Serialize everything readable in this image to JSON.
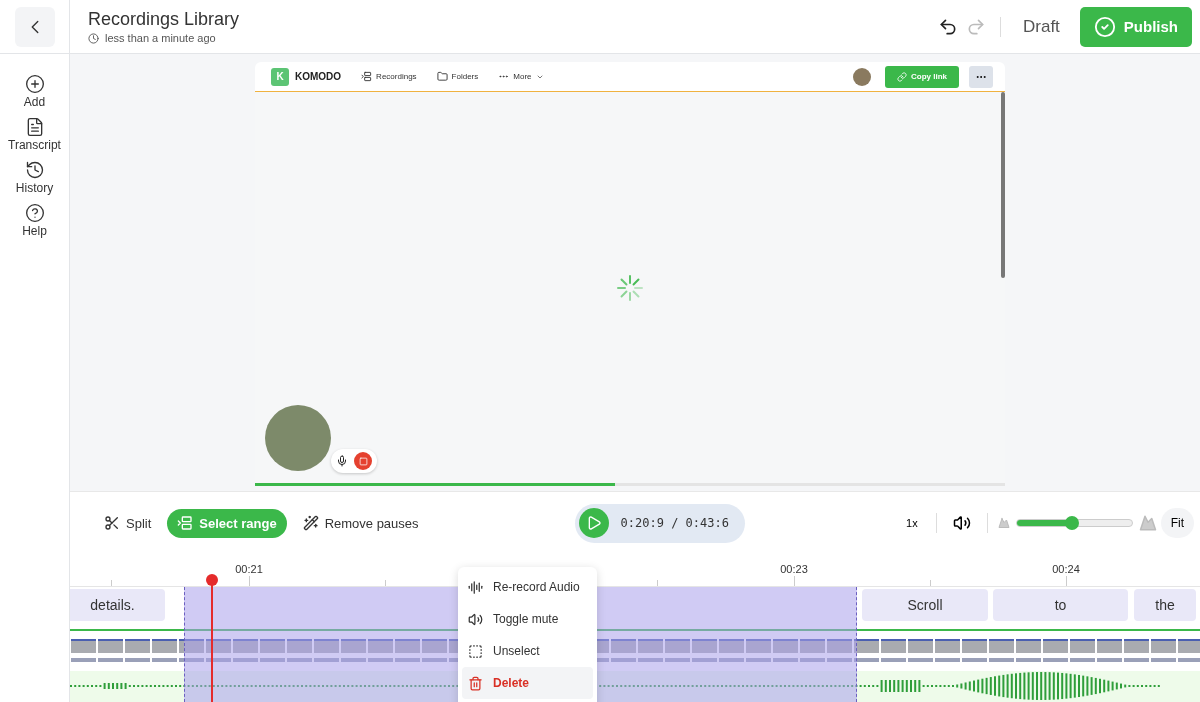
{
  "header": {
    "title": "Recordings Library",
    "subtitle": "less than a minute ago",
    "status": "Draft",
    "publish": "Publish"
  },
  "sidebar": {
    "items": [
      {
        "label": "Add",
        "kind": "add"
      },
      {
        "label": "Transcript",
        "kind": "transcript"
      },
      {
        "label": "History",
        "kind": "history"
      },
      {
        "label": "Help",
        "kind": "help"
      }
    ]
  },
  "preview": {
    "brand_letter": "K",
    "brand": "KOMODO",
    "nav": [
      {
        "label": "Recordings",
        "kind": "recordings"
      },
      {
        "label": "Folders",
        "kind": "folders"
      },
      {
        "label": "More",
        "kind": "more"
      }
    ],
    "copy_link": "Copy link",
    "progress": {
      "level": 0.48
    }
  },
  "toolbar": {
    "tools": [
      {
        "label": "Split",
        "kind": "split",
        "selected": false
      },
      {
        "label": "Select range",
        "kind": "range",
        "selected": true
      },
      {
        "label": "Remove pauses",
        "kind": "pauses",
        "selected": false
      }
    ],
    "time": "0:20:9 / 0:43:6",
    "speed": "1x",
    "zoom": {
      "level": 0.48
    },
    "fit": "Fit"
  },
  "timeline": {
    "ticks": [
      "00:21",
      "00:23",
      "00:24"
    ],
    "words": [
      "details.",
      "Scroll",
      "to",
      "the"
    ],
    "menu": [
      {
        "label": "Re-record Audio",
        "kind": "record",
        "selected": false
      },
      {
        "label": "Toggle mute",
        "kind": "mute",
        "selected": false
      },
      {
        "label": "Unselect",
        "kind": "unselect",
        "selected": false
      },
      {
        "label": "Delete",
        "kind": "delete",
        "selected": true
      }
    ]
  }
}
